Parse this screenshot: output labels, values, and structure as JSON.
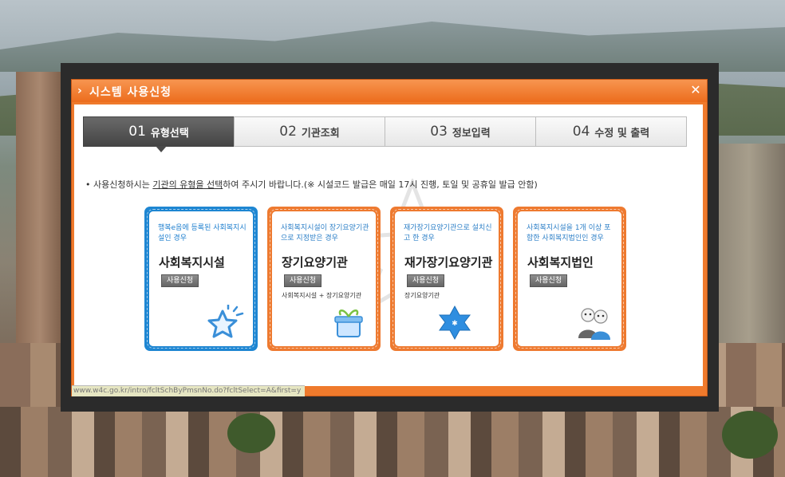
{
  "dialog": {
    "title": "시스템 사용신청",
    "close_glyph": "✕"
  },
  "steps": [
    {
      "num": "01",
      "label": "유형선택",
      "active": true
    },
    {
      "num": "02",
      "label": "기관조회",
      "active": false
    },
    {
      "num": "03",
      "label": "정보입력",
      "active": false
    },
    {
      "num": "04",
      "label": "수정 및 출력",
      "active": false
    }
  ],
  "notice": {
    "prefix": "• 사용신청하시는 ",
    "underlined": "기관의 유형을 선택",
    "suffix": "하여 주시기 바랍니다.(※ 시설코드 발급은 매일 17시 진행, 토일 및 공휴일 발급 안함)"
  },
  "cards": [
    {
      "color": "blue",
      "desc": "행복e음에 등록된 사회복지시설인 경우",
      "title": "사회복지시설",
      "button": "사용신청",
      "sub": "",
      "icon": "star-icon"
    },
    {
      "color": "orange",
      "desc": "사회복지시설이 장기요양기관으로 지정받은 경우",
      "title": "장기요양기관",
      "button": "사용신청",
      "sub": "사회복지시설 + 장기요양기관",
      "icon": "gift-box-icon"
    },
    {
      "color": "orange",
      "desc": "재가장기요양기관으로 설치신고 한 경우",
      "title": "재가장기요양기관",
      "button": "사용신청",
      "sub": "장기요양기관",
      "icon": "snowflake-star-icon"
    },
    {
      "color": "orange",
      "desc": "사회복지시설을 1개 이상 포함한 사회복지법인인 경우",
      "title": "사회복지법인",
      "button": "사용신청",
      "sub": "",
      "icon": "people-icon"
    }
  ],
  "status_url": "www.w4c.go.kr/intro/fcltSchByPmsnNo.do?fcltSelect=A&first=y",
  "colors": {
    "accent_orange": "#ef7a2c",
    "accent_blue": "#1e86d2"
  }
}
